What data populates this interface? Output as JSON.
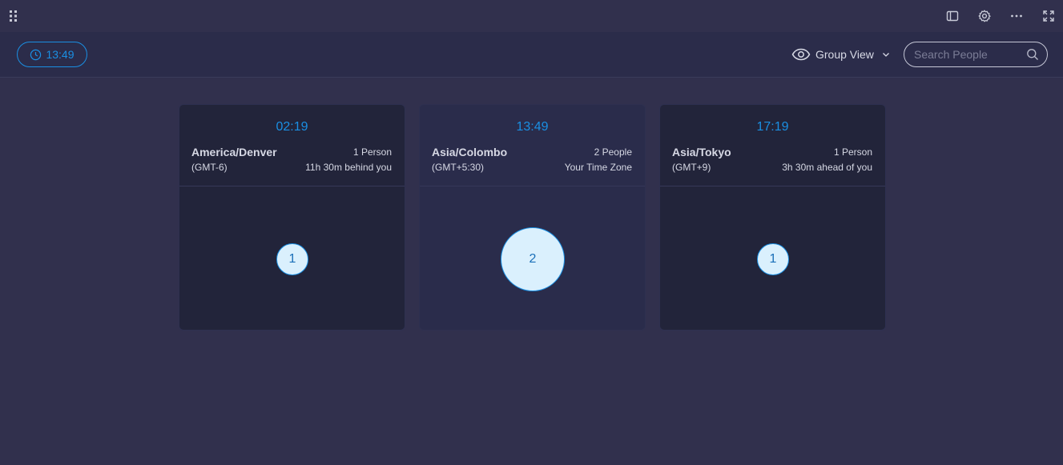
{
  "topbar": {
    "icons": [
      "grip-icon",
      "panel-icon",
      "gear-icon",
      "more-icon",
      "fullscreen-icon"
    ]
  },
  "toolbar": {
    "current_time": "13:49",
    "view_label": "Group View",
    "search_placeholder": "Search People"
  },
  "cards": [
    {
      "time": "02:19",
      "zone": "America/Denver",
      "count": "1 Person",
      "offset": "(GMT-6)",
      "relative": "11h 30m behind you",
      "people": "1"
    },
    {
      "time": "13:49",
      "zone": "Asia/Colombo",
      "count": "2 People",
      "offset": "(GMT+5:30)",
      "relative": "Your Time Zone",
      "people": "2"
    },
    {
      "time": "17:19",
      "zone": "Asia/Tokyo",
      "count": "1 Person",
      "offset": "(GMT+9)",
      "relative": "3h 30m ahead of you",
      "people": "1"
    }
  ],
  "colors": {
    "accent": "#1a8fe3",
    "background": "#31304d",
    "toolbar": "#2b2c4a",
    "card": "#22243a",
    "card_current": "#2a2c4b",
    "bubble_fill": "#daf0fd"
  }
}
